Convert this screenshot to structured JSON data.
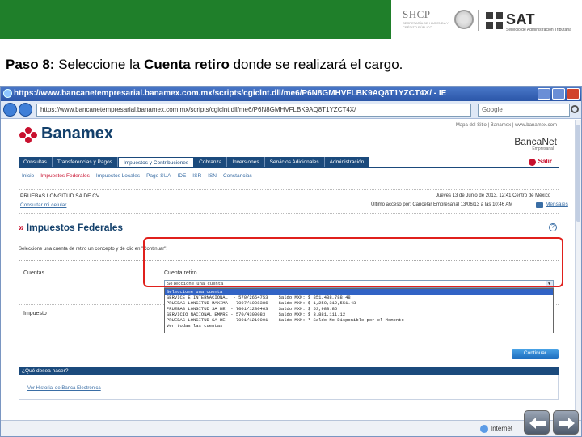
{
  "slide": {
    "shcp_logo_text": "SHCP",
    "shcp_sub_text": "SECRETARÍA DE HACIENDA Y CRÉDITO PÚBLICO",
    "sat_logo_text": "SAT",
    "sat_sub_text": "Servicio de Administración Tributaria",
    "step_bold": "Paso 8:",
    "step_text_1": " Seleccione la ",
    "step_text_bold2": "Cuenta retiro",
    "step_text_2": " donde se realizará el cargo."
  },
  "browser": {
    "title": "https://www.bancanetempresarial.banamex.com.mx/scripts/cgiclnt.dll/me6/P6N8GMHVFLBK9AQ8T1YZCT4X/ - IE",
    "url": "https://www.bancanetempresarial.banamex.com.mx/scripts/cgiclnt.dll/me6/P6N8GMHVFLBK9AQ8T1YZCT4X/",
    "search_placeholder": "Google",
    "status_zone": "Internet"
  },
  "banamex": {
    "brand": "Banamex",
    "top_links": "Mapa del Sitio | Banamex | www.banamex.com",
    "product": "BancaNet",
    "product_sub": "Empresarial",
    "salir": "Salir",
    "main_nav": [
      "Consultas",
      "Transferencias y Pagos",
      "Impuestos y Contribuciones",
      "Cobranza",
      "Inversiones",
      "Servicios Adicionales",
      "Administración"
    ],
    "main_nav_active_index": 2,
    "sub_nav": [
      "Inicio",
      "Impuestos Federales",
      "Impuestos Locales",
      "Pago SUA",
      "IDE",
      "ISR",
      "ISN",
      "Constancias"
    ],
    "sub_nav_active_index": 1,
    "company": "PRUEBAS LONGITUD SA DE CV",
    "consultar": "Consultar mi celular",
    "date_info": "Jueves 13 de Junio de 2013, 12:41 Centro de México",
    "last_access": "Último acceso por: Cancelar Empresarial 13/06/13 a las 10:46 AM",
    "mensajes": "Mensajes",
    "section_title": "Impuestos Federales",
    "instructions": "Seleccione una cuenta de retiro un concepto y dé clic en \"Continuar\".",
    "label_cuenta": "Cuentas",
    "label_cuenta_retiro": "Cuenta retiro",
    "label_impuesto": "Impuesto",
    "select_value": "Seleccione una cuenta",
    "dropdown_options": [
      "Seleccione una cuenta",
      "SERVICE E INTERNACIONAL  - 570/2654753    Saldo MXN: $ 851,488,788.48",
      "PRUEBAS LONGITUD MAXIMA - 7007/1008386    Saldo MXN: $ 1,250,312,551.43",
      "PRUEBAS LONGITUD SA DE  - 7001/1280463    Saldo MXN: $ 53,988.86",
      "SERVICIO NACIONAL EMPRE - 570/4300083     Saldo MXN: $ 3,881,111.12",
      "PRUEBAS LONGITUD SA DE  - 7001/1219001    Saldo MXN: * Saldo No Disponible por el Momento",
      "Ver todas las cuentas"
    ],
    "dropdown_selected_index": 0,
    "continuar": "Continuar",
    "que_desea": "¿Qué desea hacer?",
    "ver_historial": "Ver Historial de Banca Electrónica"
  },
  "colors": {
    "green_bar": "#1f7f2a",
    "banamex_blue": "#1b4a7c",
    "banamex_red": "#c8102e",
    "highlight_red": "#e0201c",
    "selected_option": "#3163c5"
  }
}
